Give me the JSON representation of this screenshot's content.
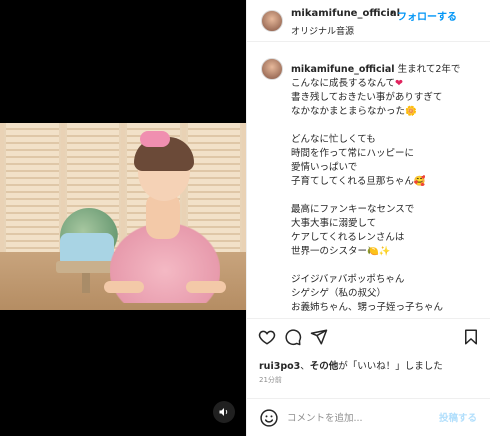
{
  "post": {
    "username": "mikamifune_official",
    "separator": "•",
    "follow_label": "フォローする",
    "audio_label": "オリジナル音源"
  },
  "caption": {
    "username": "mikamifune_official",
    "line1": " 生まれて2年で",
    "line2": "こんなに成長するなんて",
    "heart": "❤",
    "body": "\n書き残しておきたい事がありすぎて\nなかなかまとまらなかった🌼\n\nどんなに忙しくても\n時間を作って常にハッピーに\n愛情いっぱいで\n子育てしてくれる旦那ちゃん🥰\n\n最高にファンキーなセンスで\n大事大事に溺愛して\nケアしてくれるレンさんは\n世界一のシスター🍋✨\n\nジイジバァバポッポちゃん\nシゲシゲ（私の叔父）\nお義姉ちゃん、甥っ子姪っ子ちゃん"
  },
  "likes": {
    "user": "rui3po3",
    "sep": "、",
    "others": "その他",
    "text": "が「いいね！」しました"
  },
  "timestamp": "21分前",
  "comment": {
    "placeholder": "コメントを追加...",
    "post_label": "投稿する"
  },
  "icons": {
    "like": "heart-outline-icon",
    "comment": "comment-bubble-icon",
    "share": "paper-plane-icon",
    "save": "bookmark-icon",
    "emoji": "smiley-icon",
    "sound": "speaker-icon"
  },
  "colors": {
    "accent": "#0095f6",
    "post_disabled": "#b2dffc",
    "heart": "#e0245e"
  }
}
